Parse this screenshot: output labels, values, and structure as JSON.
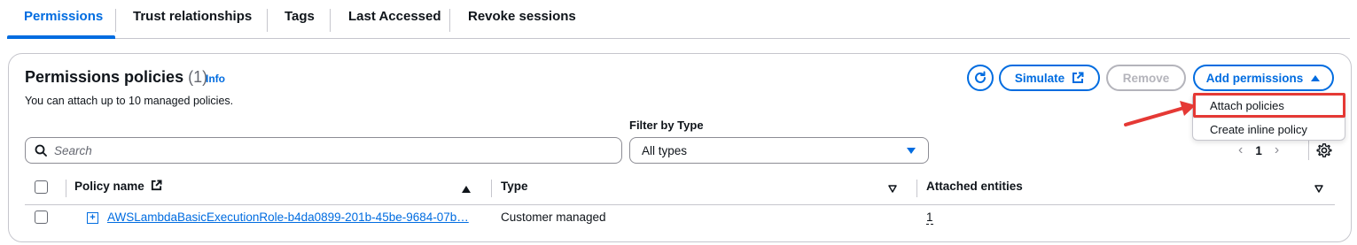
{
  "tabs": [
    {
      "label": "Permissions",
      "active": true
    },
    {
      "label": "Trust relationships",
      "active": false
    },
    {
      "label": "Tags",
      "active": false
    },
    {
      "label": "Last Accessed",
      "active": false
    },
    {
      "label": "Revoke sessions",
      "active": false
    }
  ],
  "panel": {
    "title": "Permissions policies",
    "count": "(1)",
    "info_label": "Info",
    "description": "You can attach up to 10 managed policies."
  },
  "actions": {
    "refresh_icon": "refresh-icon",
    "simulate_label": "Simulate",
    "remove_label": "Remove",
    "add_permissions_label": "Add permissions"
  },
  "menu": {
    "items": [
      {
        "label": "Attach policies",
        "highlighted": true
      },
      {
        "label": "Create inline policy",
        "highlighted": false
      }
    ]
  },
  "filter": {
    "search_placeholder": "Search",
    "type_label": "Filter by Type",
    "type_selected": "All types"
  },
  "pagination": {
    "current_page": "1"
  },
  "table": {
    "columns": [
      "Policy name",
      "Type",
      "Attached entities"
    ],
    "rows": [
      {
        "policy_name": "AWSLambdaBasicExecutionRole-b4da0899-201b-45be-9684-07b…",
        "type": "Customer managed",
        "attached_entities": "1"
      }
    ]
  },
  "colors": {
    "accent": "#006ce0",
    "annotation": "#e53935",
    "disabled": "#b4b4bb"
  }
}
